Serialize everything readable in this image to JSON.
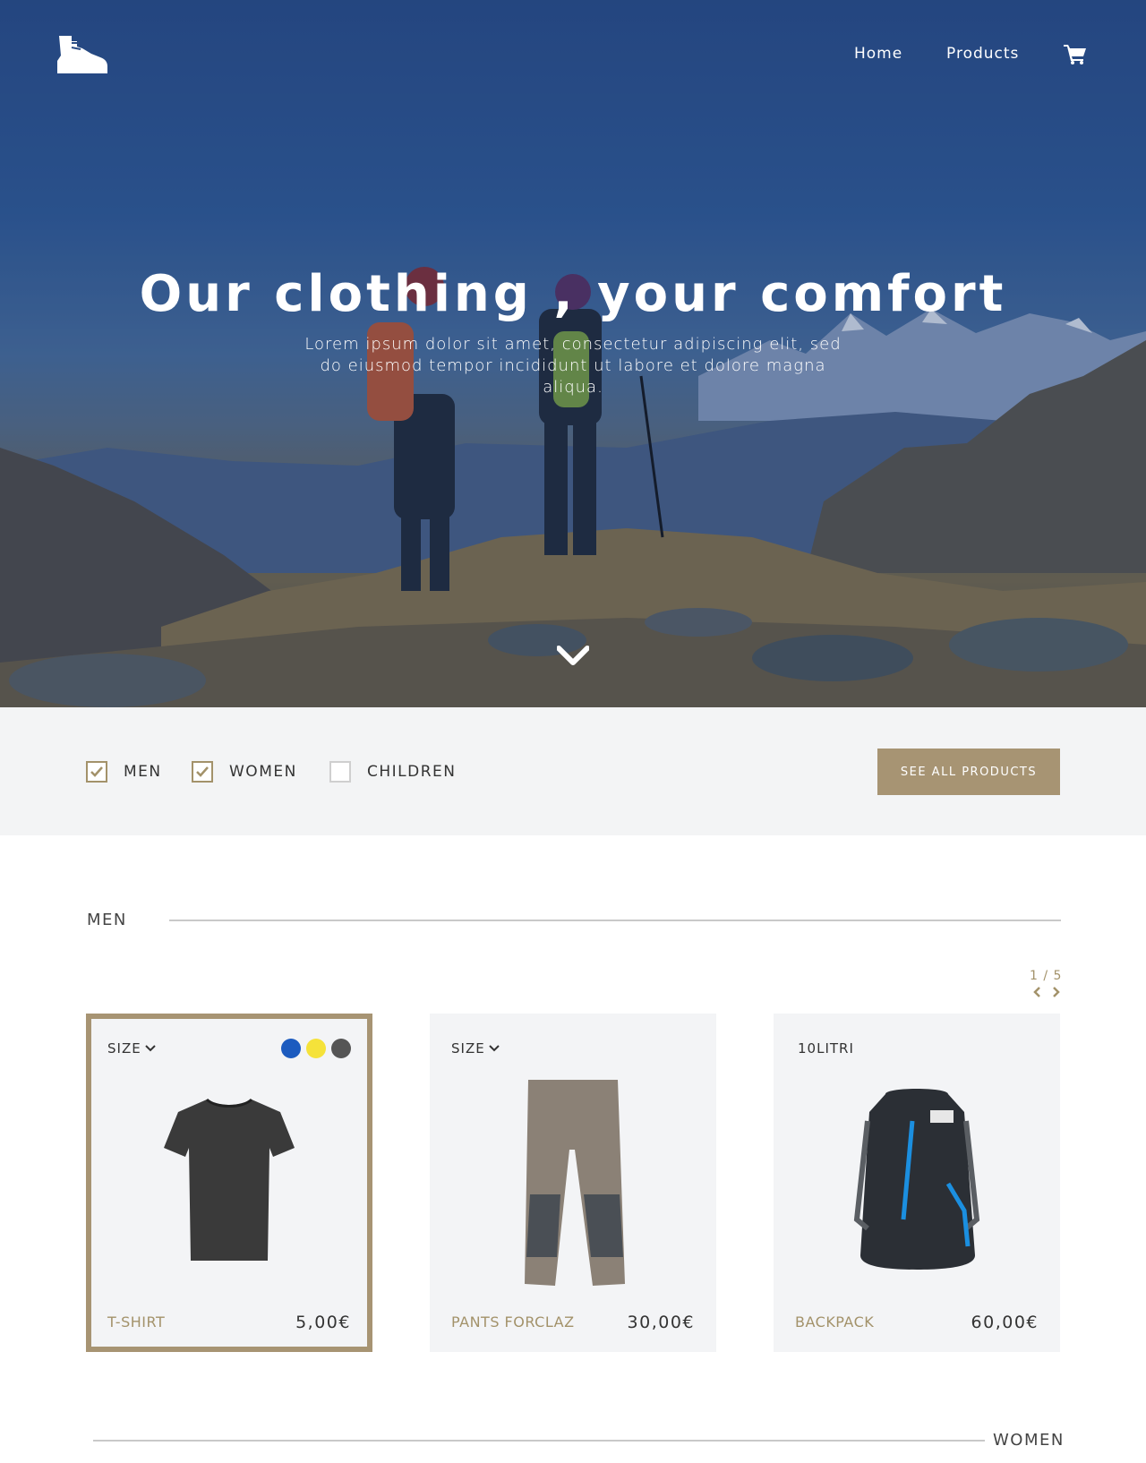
{
  "nav": {
    "home": "Home",
    "products": "Products",
    "logo_icon": "hiking-boot-icon",
    "cart_icon": "shopping-cart-icon"
  },
  "hero": {
    "title": "Our clothing , your comfort",
    "subtitle": "Lorem ipsum dolor sit amet, consectetur adipiscing elit, sed do eiusmod tempor incididunt ut labore et dolore magna aliqua.",
    "scroll_icon": "chevron-down-icon"
  },
  "filters": [
    {
      "label": "MEN",
      "checked": true
    },
    {
      "label": "WOMEN",
      "checked": true
    },
    {
      "label": "CHILDREN",
      "checked": false
    }
  ],
  "see_all_label": "SEE ALL PRODUCTS",
  "sections": {
    "men_title": "MEN",
    "women_title": "WOMEN"
  },
  "pager": {
    "count": "1 / 5"
  },
  "products": [
    {
      "size_label": "SIZE",
      "name": "T-SHIRT",
      "price": "5,00€",
      "colors": [
        "#1c5bbf",
        "#f5e23a",
        "#555555"
      ]
    },
    {
      "size_label": "SIZE",
      "name": "PANTS FORCLAZ",
      "price": "30,00€"
    },
    {
      "size_label": "10LITRI",
      "name": "BACKPACK",
      "price": "60,00€"
    }
  ]
}
